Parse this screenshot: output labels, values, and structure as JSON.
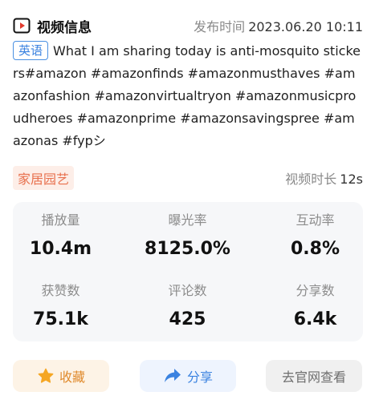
{
  "header": {
    "icon": "video-play-icon",
    "title": "视频信息",
    "publish_label": "发布时间",
    "publish_value": "2023.06.20 10:11"
  },
  "description": {
    "language_tag": "英语",
    "text": "What I am sharing today is anti-mosquito stickers#amazon #amazonfinds #amazonmusthaves #amazonfashion #amazonvirtualtryon #amazonmusicproudheroes #amazonprime #amazonsavingspree #amazonas #fypシ"
  },
  "category": {
    "tag": "家居园艺",
    "duration_label": "视频时长",
    "duration_value": "12s"
  },
  "stats": [
    {
      "label": "播放量",
      "value": "10.4m"
    },
    {
      "label": "曝光率",
      "value": "8125.0%"
    },
    {
      "label": "互动率",
      "value": "0.8%"
    },
    {
      "label": "获赞数",
      "value": "75.1k"
    },
    {
      "label": "评论数",
      "value": "425"
    },
    {
      "label": "分享数",
      "value": "6.4k"
    }
  ],
  "actions": {
    "favorite_label": "收藏",
    "share_label": "分享",
    "site_label": "去官网查看"
  },
  "colors": {
    "accent_blue": "#3a82e0",
    "category_orange": "#e8704d",
    "favorite_orange": "#f5a623"
  }
}
